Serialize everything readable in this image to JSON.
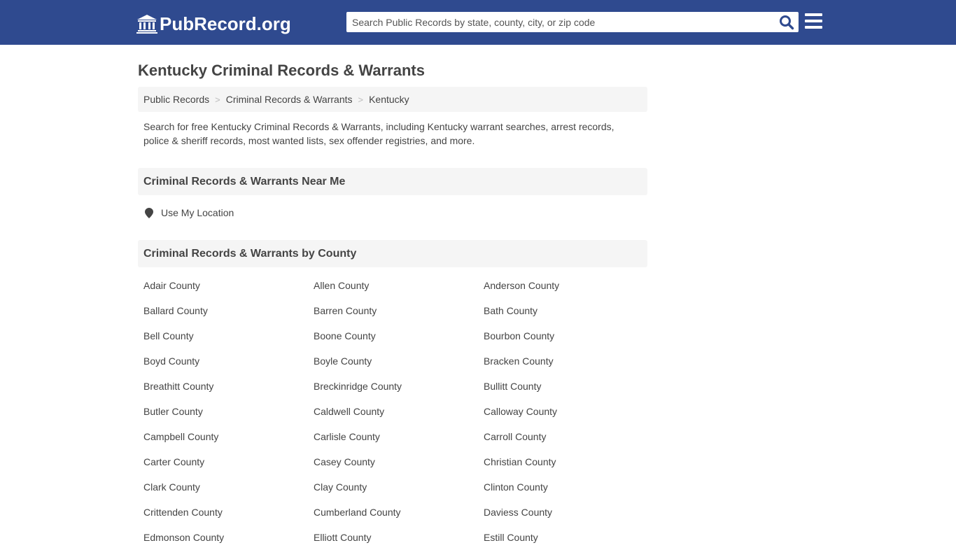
{
  "header": {
    "logo_text": "PubRecord.org",
    "search_placeholder": "Search Public Records by state, county, city, or zip code",
    "colors": {
      "bar": "#2f4a8f",
      "search_icon": "#2f4a8f"
    }
  },
  "page": {
    "title": "Kentucky Criminal Records & Warrants",
    "breadcrumb": [
      "Public Records",
      "Criminal Records & Warrants",
      "Kentucky"
    ],
    "intro": "Search for free Kentucky Criminal Records & Warrants, including Kentucky warrant searches, arrest records, police & sheriff records, most wanted lists, sex offender registries, and more."
  },
  "near_me": {
    "heading": "Criminal Records & Warrants Near Me",
    "location_label": "Use My Location"
  },
  "by_county": {
    "heading": "Criminal Records & Warrants by County",
    "counties": [
      "Adair County",
      "Allen County",
      "Anderson County",
      "Ballard County",
      "Barren County",
      "Bath County",
      "Bell County",
      "Boone County",
      "Bourbon County",
      "Boyd County",
      "Boyle County",
      "Bracken County",
      "Breathitt County",
      "Breckinridge County",
      "Bullitt County",
      "Butler County",
      "Caldwell County",
      "Calloway County",
      "Campbell County",
      "Carlisle County",
      "Carroll County",
      "Carter County",
      "Casey County",
      "Christian County",
      "Clark County",
      "Clay County",
      "Clinton County",
      "Crittenden County",
      "Cumberland County",
      "Daviess County",
      "Edmonson County",
      "Elliott County",
      "Estill County"
    ]
  }
}
